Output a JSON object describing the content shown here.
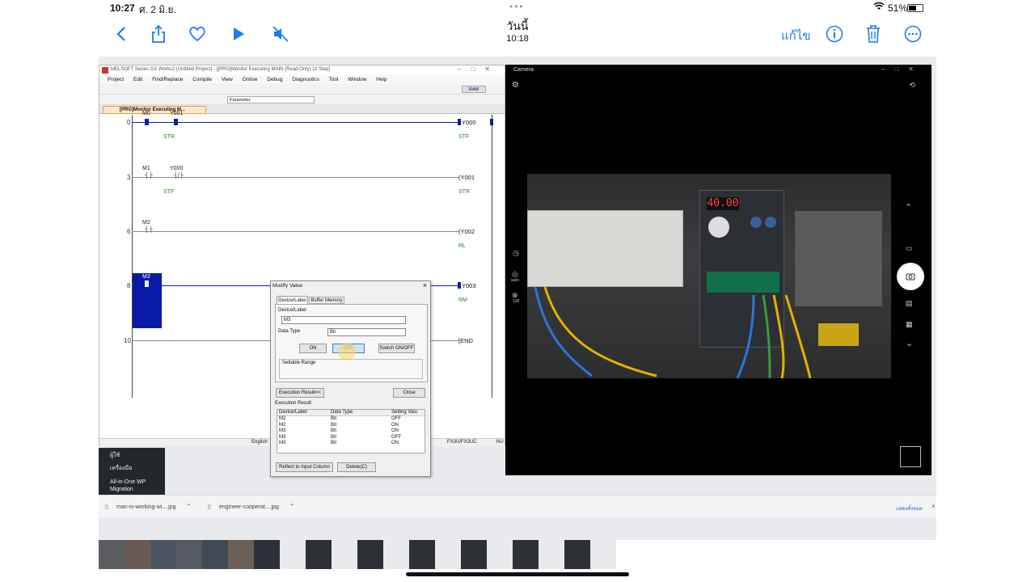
{
  "status": {
    "time": "10:27",
    "date": "ศ. 2 มิ.ย.",
    "battery": "51%"
  },
  "nav": {
    "title": "วันนี้",
    "subtitle": "10:18",
    "edit": "แก้ไข"
  },
  "gx": {
    "title": "MELSOFT Series GX Works2 (Untitled Project) - [[PRG]Monitor Executing MAIN (Read Only) 11 Step]",
    "menus": [
      "Project",
      "Edit",
      "Find/Replace",
      "Compile",
      "View",
      "Online",
      "Debug",
      "Diagnostics",
      "Tool",
      "Window",
      "Help"
    ],
    "ram": "RAM",
    "parameter": "Parameter",
    "tab": "[PRG]Monitor Executing M...",
    "rungs": [
      {
        "num": "0",
        "c1": "M0",
        "c2": "Y001",
        "d1": "STR",
        "coil": "Y000",
        "cdev": "STF"
      },
      {
        "num": "3",
        "c1": "M1",
        "c2": "Y000",
        "d1": "STF",
        "coil": "(Y001",
        "cdev": "STR"
      },
      {
        "num": "6",
        "c1": "M2",
        "c2": "",
        "d1": "",
        "coil": "(Y002",
        "cdev": "RL"
      },
      {
        "num": "8",
        "c1": "M3",
        "c2": "",
        "d1": "",
        "coil": "Y003",
        "cdev": "RM"
      },
      {
        "num": "10",
        "c1": "",
        "c2": "",
        "d1": "",
        "coil": "[END",
        "cdev": ""
      }
    ],
    "status_lang": "English",
    "status_cpu": "FX3U/FX3UC",
    "status_extra": "NU"
  },
  "dialog": {
    "title": "Modify Value",
    "tab1": "Device/Label",
    "tab2": "Buffer Memory",
    "device_label": "Device/Label",
    "device_value": "M3",
    "datatype_label": "Data Type",
    "datatype_value": "Bit",
    "on": "ON",
    "off": "OFF",
    "switch": "Switch ON/OFF",
    "range": "Settable Range",
    "exec_btn": "Execution Result<<",
    "close": "Close",
    "result_title": "Execution Result",
    "cols": [
      "Device/Label",
      "Data Type",
      "Setting Valu"
    ],
    "rows": [
      [
        "M2",
        "Bit",
        "OFF"
      ],
      [
        "M2",
        "Bit",
        "ON"
      ],
      [
        "M3",
        "Bit",
        "ON"
      ],
      [
        "M3",
        "Bit",
        "OFF"
      ],
      [
        "M3",
        "Bit",
        "ON"
      ]
    ],
    "reflect": "Reflect to Input Column",
    "delete": "Delete(C)"
  },
  "camera": {
    "title": "Camera",
    "display": "40.00",
    "auto": "auto",
    "iso": "128"
  },
  "sidebar": [
    {
      "label": "ผู้ใช้"
    },
    {
      "label": "เครื่องมือ"
    },
    {
      "label": "All-in-One WP Migration"
    }
  ],
  "downloads": {
    "files": [
      "man-is-working-wi....jpg",
      "engineer-cooperat....jpg"
    ],
    "show_all": "แสดงทั้งหมด"
  },
  "colors": {
    "accent": "#1a7cf5",
    "ladder_blue": "#0a1aa8",
    "green_text": "#1a8a1a"
  }
}
